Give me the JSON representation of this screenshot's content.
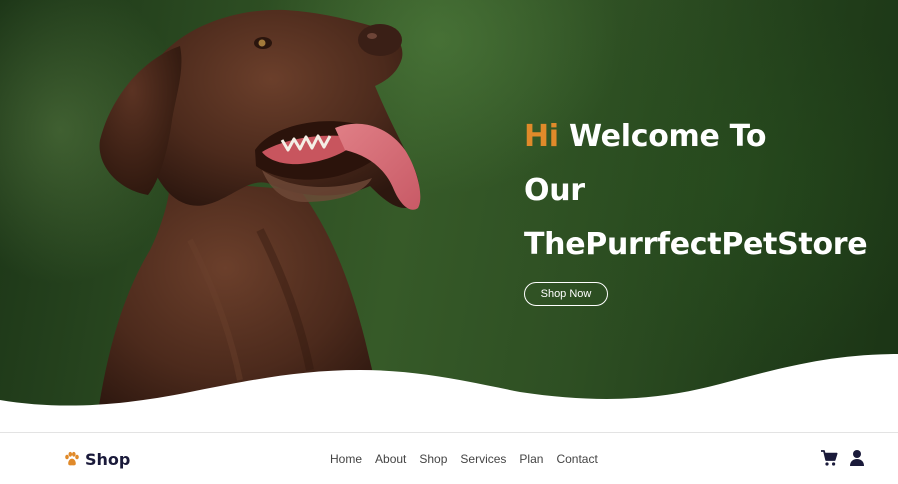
{
  "hero": {
    "greeting": "Hi",
    "line1_rest": "Welcome To",
    "line2": "Our",
    "line3": "ThePurrfectPetStore",
    "cta_label": "Shop Now",
    "image": "chocolate-labrador-photo"
  },
  "navbar": {
    "brand_label": "Shop",
    "brand_icon": "paw-icon",
    "links": [
      "Home",
      "About",
      "Shop",
      "Services",
      "Plan",
      "Contact"
    ],
    "cart_icon": "shopping-cart-icon",
    "user_icon": "user-icon"
  },
  "colors": {
    "accent": "#e08a2a",
    "brand_text": "#1a1a3a",
    "hero_bg": "#2c4c22",
    "dog_fur": "#5a3524"
  }
}
